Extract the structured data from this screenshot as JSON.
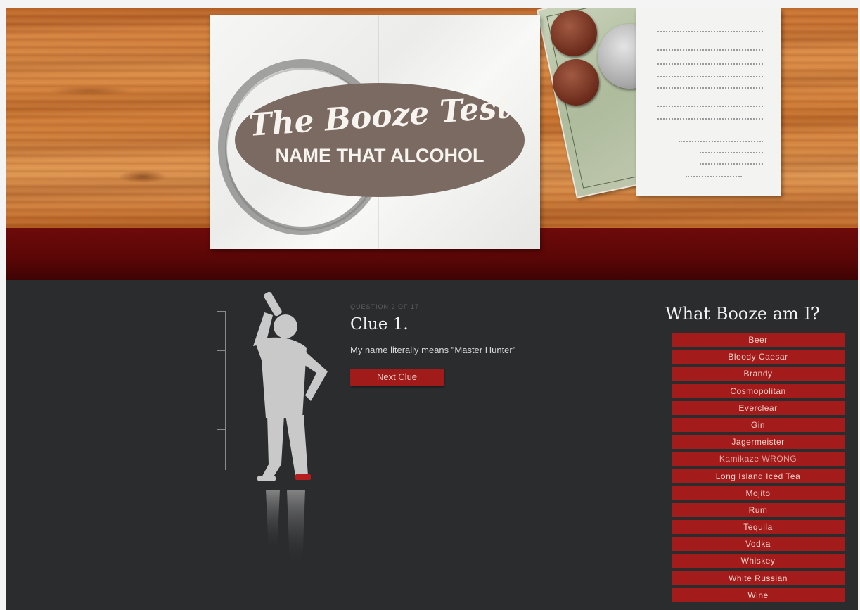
{
  "header": {
    "logo_line1": "The Booze Test",
    "logo_line2": "NAME THAT ALCOHOL"
  },
  "quiz": {
    "question_count": "QUESTION 2 OF 17",
    "clue_title": "Clue 1.",
    "clue_text": "My name literally means \"Master Hunter\"",
    "next_button": "Next Clue"
  },
  "scale_labels": [
    "",
    "",
    "",
    "",
    ""
  ],
  "answers": {
    "title": "What Booze am I?",
    "options": [
      {
        "label": "Beer",
        "state": "normal"
      },
      {
        "label": "Bloody Caesar",
        "state": "normal"
      },
      {
        "label": "Brandy",
        "state": "normal"
      },
      {
        "label": "Cosmopolitan",
        "state": "normal"
      },
      {
        "label": "Everclear",
        "state": "normal"
      },
      {
        "label": "Gin",
        "state": "normal"
      },
      {
        "label": "Jagermeister",
        "state": "normal"
      },
      {
        "label": "Kamikaze WRONG",
        "state": "wrong"
      },
      {
        "label": "Long Island Iced Tea",
        "state": "normal"
      },
      {
        "label": "Mojito",
        "state": "normal"
      },
      {
        "label": "Rum",
        "state": "normal"
      },
      {
        "label": "Tequila",
        "state": "normal"
      },
      {
        "label": "Vodka",
        "state": "normal"
      },
      {
        "label": "Whiskey",
        "state": "normal"
      },
      {
        "label": "White Russian",
        "state": "normal"
      },
      {
        "label": "Wine",
        "state": "normal"
      }
    ]
  },
  "colors": {
    "accent_red": "#a31b1b",
    "band_red": "#5a0606",
    "background_dark": "#2b2c2e"
  }
}
